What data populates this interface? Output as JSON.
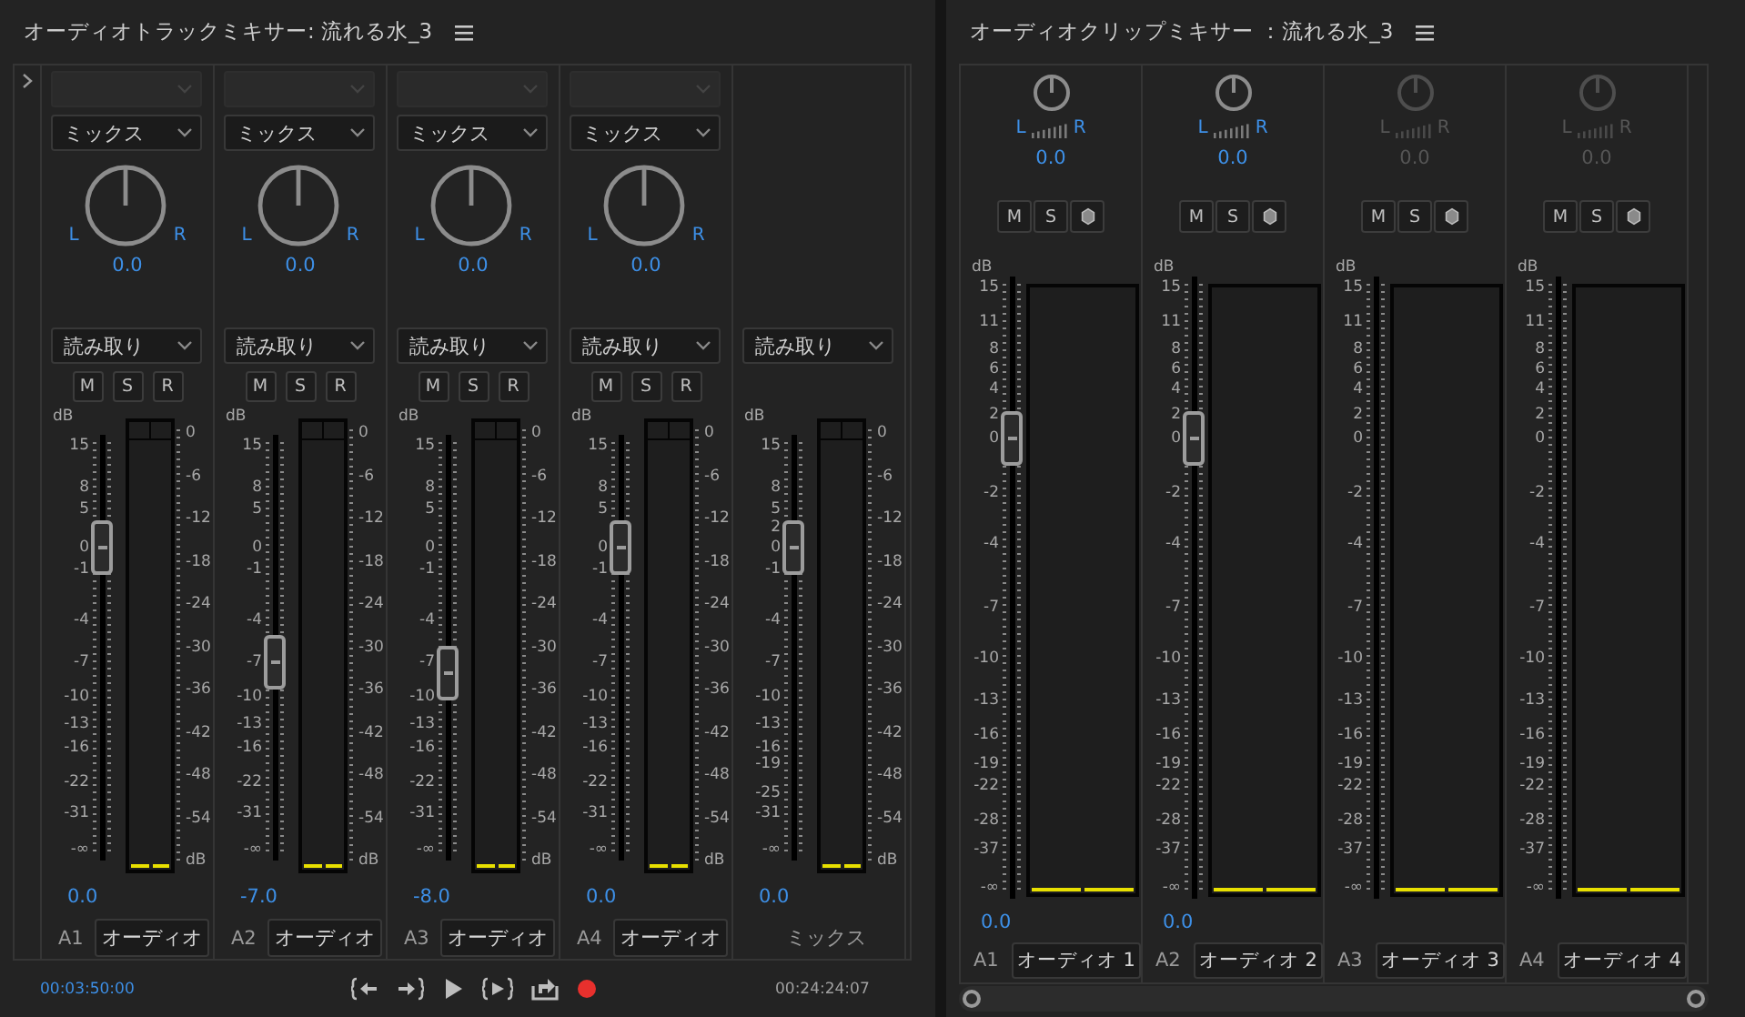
{
  "track_mixer": {
    "title": "オーディオトラックミキサー: 流れる水_3",
    "channels": [
      {
        "kind": "track",
        "input": {
          "disabled": true
        },
        "mode": "ミックス",
        "pan_labels": [
          "L",
          "R"
        ],
        "pan": "0.0",
        "automation": "読み取り",
        "buttons": [
          "M",
          "S",
          "R"
        ],
        "unit": "dB",
        "scale": [
          "15",
          "8",
          "5",
          "0",
          "-1",
          "-4",
          "-7",
          "-10",
          "-13",
          "-16",
          "-22",
          "-31",
          "-∞"
        ],
        "meter_scale": [
          "0",
          "-6",
          "-12",
          "-18",
          "-24",
          "-30",
          "-36",
          "-42",
          "-48",
          "-54",
          "dB"
        ],
        "value": "0.0",
        "track": "A1",
        "name": "オーディオ"
      },
      {
        "kind": "track",
        "input": {
          "disabled": true
        },
        "mode": "ミックス",
        "pan_labels": [
          "L",
          "R"
        ],
        "pan": "0.0",
        "automation": "読み取り",
        "buttons": [
          "M",
          "S",
          "R"
        ],
        "unit": "dB",
        "scale": [
          "15",
          "8",
          "5",
          "0",
          "-1",
          "-4",
          "-7",
          "-10",
          "-13",
          "-16",
          "-22",
          "-31",
          "-∞"
        ],
        "meter_scale": [
          "0",
          "-6",
          "-12",
          "-18",
          "-24",
          "-30",
          "-36",
          "-42",
          "-48",
          "-54",
          "dB"
        ],
        "value": "-7.0",
        "track": "A2",
        "name": "オーディオ"
      },
      {
        "kind": "track",
        "input": {
          "disabled": true
        },
        "mode": "ミックス",
        "pan_labels": [
          "L",
          "R"
        ],
        "pan": "0.0",
        "automation": "読み取り",
        "buttons": [
          "M",
          "S",
          "R"
        ],
        "unit": "dB",
        "scale": [
          "15",
          "8",
          "5",
          "0",
          "-1",
          "-4",
          "-7",
          "-10",
          "-13",
          "-16",
          "-22",
          "-31",
          "-∞"
        ],
        "meter_scale": [
          "0",
          "-6",
          "-12",
          "-18",
          "-24",
          "-30",
          "-36",
          "-42",
          "-48",
          "-54",
          "dB"
        ],
        "value": "-8.0",
        "track": "A3",
        "name": "オーディオ"
      },
      {
        "kind": "track",
        "input": {
          "disabled": true
        },
        "mode": "ミックス",
        "pan_labels": [
          "L",
          "R"
        ],
        "pan": "0.0",
        "automation": "読み取り",
        "buttons": [
          "M",
          "S",
          "R"
        ],
        "unit": "dB",
        "scale": [
          "15",
          "8",
          "5",
          "0",
          "-1",
          "-4",
          "-7",
          "-10",
          "-13",
          "-16",
          "-22",
          "-31",
          "-∞"
        ],
        "meter_scale": [
          "0",
          "-6",
          "-12",
          "-18",
          "-24",
          "-30",
          "-36",
          "-42",
          "-48",
          "-54",
          "dB"
        ],
        "value": "0.0",
        "track": "A4",
        "name": "オーディオ"
      },
      {
        "kind": "mix",
        "automation": "読み取り",
        "unit": "dB",
        "scale": [
          "15",
          "8",
          "5",
          "2",
          "0",
          "-1",
          "-4",
          "-7",
          "-10",
          "-13",
          "-16",
          "-19",
          "-25",
          "-31",
          "-∞"
        ],
        "meter_scale": [
          "0",
          "-6",
          "-12",
          "-18",
          "-24",
          "-30",
          "-36",
          "-42",
          "-48",
          "-54",
          "dB"
        ],
        "value": "0.0",
        "name": "ミックス"
      }
    ],
    "timecode_in": "00:03:50:00",
    "timecode_out": "00:24:24:07"
  },
  "clip_mixer": {
    "title": "オーディオクリップミキサー ：流れる水_3",
    "channels": [
      {
        "disabled": false,
        "pan_labels": [
          "L",
          "R"
        ],
        "pan": "0.0",
        "buttons": [
          "M",
          "S"
        ],
        "unit": "dB",
        "scale": [
          "15",
          "11",
          "8",
          "6",
          "4",
          "2",
          "0",
          "-2",
          "-4",
          "-7",
          "-10",
          "-13",
          "-16",
          "-19",
          "-22",
          "-28",
          "-37",
          "-∞"
        ],
        "value": "0.0",
        "track": "A1",
        "name": "オーディオ 1"
      },
      {
        "disabled": false,
        "pan_labels": [
          "L",
          "R"
        ],
        "pan": "0.0",
        "buttons": [
          "M",
          "S"
        ],
        "unit": "dB",
        "scale": [
          "15",
          "11",
          "8",
          "6",
          "4",
          "2",
          "0",
          "-2",
          "-4",
          "-7",
          "-10",
          "-13",
          "-16",
          "-19",
          "-22",
          "-28",
          "-37",
          "-∞"
        ],
        "value": "0.0",
        "track": "A2",
        "name": "オーディオ 2"
      },
      {
        "disabled": true,
        "pan_labels": [
          "L",
          "R"
        ],
        "pan": "0.0",
        "buttons": [
          "M",
          "S"
        ],
        "unit": "dB",
        "scale": [
          "15",
          "11",
          "8",
          "6",
          "4",
          "2",
          "0",
          "-2",
          "-4",
          "-7",
          "-10",
          "-13",
          "-16",
          "-19",
          "-22",
          "-28",
          "-37",
          "-∞"
        ],
        "track": "A3",
        "name": "オーディオ 3"
      },
      {
        "disabled": true,
        "pan_labels": [
          "L",
          "R"
        ],
        "pan": "0.0",
        "buttons": [
          "M",
          "S"
        ],
        "unit": "dB",
        "scale": [
          "15",
          "11",
          "8",
          "6",
          "4",
          "2",
          "0",
          "-2",
          "-4",
          "-7",
          "-10",
          "-13",
          "-16",
          "-19",
          "-22",
          "-28",
          "-37",
          "-∞"
        ],
        "track": "A4",
        "name": "オーディオ 4"
      }
    ]
  }
}
